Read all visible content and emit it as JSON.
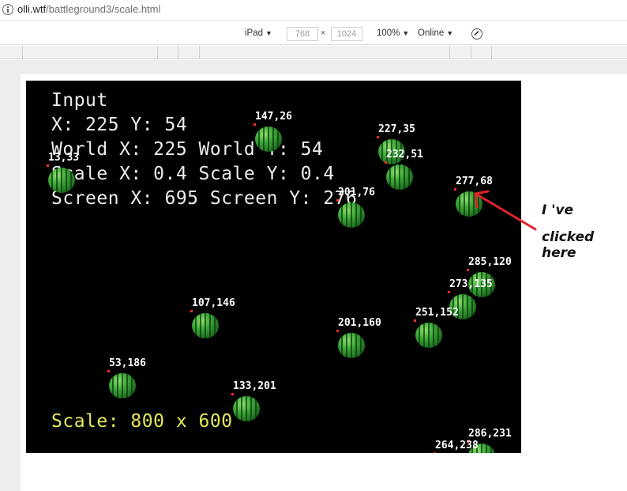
{
  "address_bar": {
    "url_host": "olli.wtf",
    "url_path": "/battleground3/scale.html"
  },
  "device_toolbar": {
    "device": "iPad",
    "width": "768",
    "times": "×",
    "height": "1024",
    "zoom": "100%",
    "network": "Online",
    "caret": "▼"
  },
  "hud": {
    "lines": [
      "Input",
      "X: 225 Y: 54",
      "World X: 225 World Y: 54",
      "Scale X: 0.4 Scale Y: 0.4",
      "Screen X: 695 Screen Y: 276"
    ],
    "scale_line": "Scale: 800 x 600"
  },
  "melons": [
    {
      "label": "147,26"
    },
    {
      "label": "227,35"
    },
    {
      "label": "232,51"
    },
    {
      "label": "13,33"
    },
    {
      "label": "201,76"
    },
    {
      "label": "277,68"
    },
    {
      "label": "285,120"
    },
    {
      "label": "273,135"
    },
    {
      "label": "107,146"
    },
    {
      "label": "251,152"
    },
    {
      "label": "201,160"
    },
    {
      "label": "53,186"
    },
    {
      "label": "133,201"
    },
    {
      "label": "286,231"
    },
    {
      "label": "264,238"
    }
  ],
  "annotation": {
    "line1": "I 've",
    "line2": "clicked here"
  },
  "colors": {
    "canvas_bg": "#000000",
    "hud_text": "#ececec",
    "scale_text": "#e4e85a",
    "arrow": "#e0222b"
  }
}
